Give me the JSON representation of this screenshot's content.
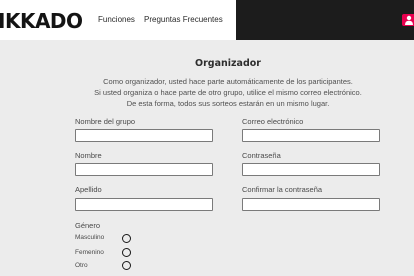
{
  "header": {
    "logo": "IKKADO",
    "nav": [
      "Funciones",
      "Preguntas Frecuentes"
    ]
  },
  "page": {
    "title": "Organizador",
    "intro": [
      "Como organizador, usted hace parte automáticamente de los participantes.",
      "Si usted organiza o hace parte de otro grupo, utilice el mismo correo electrónico.",
      "De esta forma, todos sus sorteos estarán en un mismo lugar."
    ]
  },
  "form": {
    "group_name": {
      "label": "Nombre del grupo",
      "value": ""
    },
    "email": {
      "label": "Correo electrónico",
      "value": ""
    },
    "first_name": {
      "label": "Nombre",
      "value": ""
    },
    "password": {
      "label": "Contraseña",
      "value": ""
    },
    "last_name": {
      "label": "Apellido",
      "value": ""
    },
    "confirm_password": {
      "label": "Confirmar la contraseña",
      "value": ""
    },
    "gender": {
      "label": "Género",
      "options": [
        "Masculino",
        "Femenino",
        "Otro"
      ]
    }
  },
  "colors": {
    "accent": "#e8004f",
    "dark_bar": "#1c1c1c",
    "background": "#ececec"
  }
}
